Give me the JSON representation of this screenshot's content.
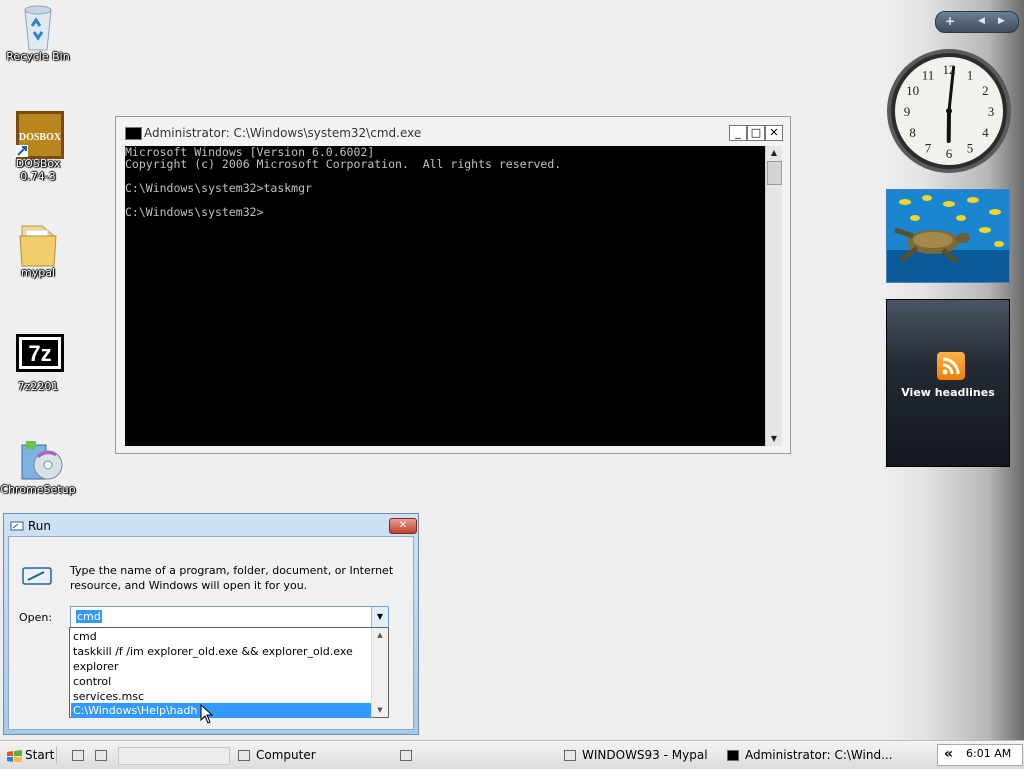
{
  "desktop_icons": [
    {
      "id": "recycle-bin",
      "label": "Recycle Bin"
    },
    {
      "id": "dosbox",
      "label": "DOSBox\n0.74-3"
    },
    {
      "id": "mypal",
      "label": "mypal"
    },
    {
      "id": "7zip",
      "label": "7z2201"
    },
    {
      "id": "chromesetup",
      "label": "ChromeSetup"
    }
  ],
  "dosbox_logo": "DOSBOX",
  "sevenzip_logo": "7z",
  "sidebar": {
    "clock": {
      "hour": 6,
      "minute": 1,
      "numerals": [
        "12",
        "1",
        "2",
        "3",
        "4",
        "5",
        "6",
        "7",
        "8",
        "9",
        "10",
        "11"
      ]
    },
    "feed": {
      "label": "View headlines"
    }
  },
  "cmd": {
    "title": "Administrator: C:\\Windows\\system32\\cmd.exe",
    "console_text": "Microsoft Windows [Version 6.0.6002]\nCopyright (c) 2006 Microsoft Corporation.  All rights reserved.\n\nC:\\Windows\\system32>taskmgr\n\nC:\\Windows\\system32>",
    "buttons": {
      "minimize": "_",
      "maximize": "□",
      "close": "✕"
    }
  },
  "run_dialog": {
    "title": "Run",
    "description": "Type the name of a program, folder, document, or Internet resource, and Windows will open it for you.",
    "open_label": "Open:",
    "open_value": "cmd",
    "history": [
      "cmd",
      "taskkill /f /im explorer_old.exe && explorer_old.exe",
      "explorer",
      "control",
      "services.msc",
      "C:\\Windows\\Help\\hadh"
    ],
    "selected_index": 5
  },
  "taskbar": {
    "start_label": "Start",
    "items": [
      "Computer",
      "WINDOWS93 - Mypal",
      "Administrator: C:\\Wind..."
    ],
    "time": "6:01 AM",
    "chevron": "«"
  },
  "colors": {
    "selection": "#3399ff",
    "console_bg": "#000000",
    "console_fg": "#c0c0c0"
  }
}
